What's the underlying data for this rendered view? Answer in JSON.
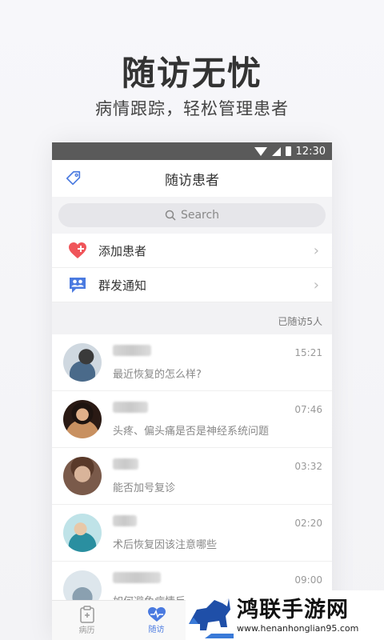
{
  "promo": {
    "title": "随访无忧",
    "subtitle": "病情跟踪，轻松管理患者"
  },
  "statusbar": {
    "time": "12:30"
  },
  "header": {
    "title": "随访患者"
  },
  "search": {
    "placeholder": "Search"
  },
  "menu": [
    {
      "label": "添加患者",
      "icon": "heart-plus-icon"
    },
    {
      "label": "群发通知",
      "icon": "group-notify-icon"
    }
  ],
  "section": {
    "count_label": "已随访5人"
  },
  "patients": [
    {
      "message": "最近恢复的怎么样?",
      "time": "15:21"
    },
    {
      "message": "头疼、偏头痛是否是神经系统问题",
      "time": "07:46"
    },
    {
      "message": "能否加号复诊",
      "time": "03:32"
    },
    {
      "message": "术后恢复因该注意哪些",
      "time": "02:20"
    },
    {
      "message": "如何避免病情反",
      "time": "09:00"
    }
  ],
  "tabs": [
    {
      "label": "病历",
      "icon": "clipboard-icon"
    },
    {
      "label": "随访",
      "icon": "heart-pulse-icon"
    }
  ],
  "watermark": {
    "title": "鸿联手游网",
    "url": "www.henanhonglian95.com"
  },
  "colors": {
    "accent": "#4a7ae0",
    "heart": "#f0555a"
  }
}
